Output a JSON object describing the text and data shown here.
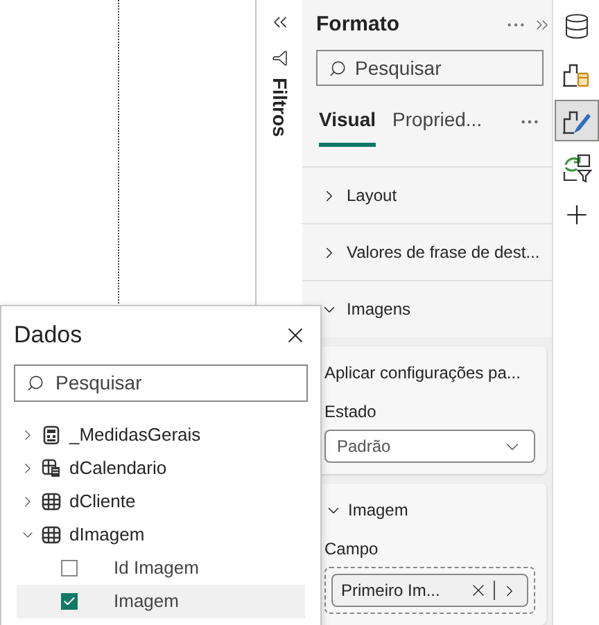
{
  "filters_pane": {
    "label": "Filtros"
  },
  "format_pane": {
    "title": "Formato",
    "search": {
      "placeholder": "Pesquisar"
    },
    "tabs": [
      {
        "label": "Visual",
        "selected": true
      },
      {
        "label": "Propried...",
        "selected": false
      }
    ],
    "sections": [
      {
        "label": "Layout",
        "expanded": false
      },
      {
        "label": "Valores de frase de dest...",
        "expanded": false
      },
      {
        "label": "Imagens",
        "expanded": true
      }
    ],
    "cards": [
      {
        "kind": "dropdown",
        "title": "Aplicar configurações pa...",
        "field_label": "Estado",
        "value": "Padrão"
      },
      {
        "kind": "field-well",
        "title": "Imagem",
        "expanded": true,
        "field_label": "Campo",
        "value": "Primeiro Im..."
      }
    ]
  },
  "rail": [
    {
      "kind": "data",
      "selected": false
    },
    {
      "kind": "build",
      "selected": false
    },
    {
      "kind": "format",
      "selected": true
    },
    {
      "kind": "analytics",
      "selected": false
    },
    {
      "kind": "add",
      "selected": false
    }
  ],
  "data_pane": {
    "title": "Dados",
    "search": {
      "placeholder": "Pesquisar"
    },
    "tree": [
      {
        "label": "_MedidasGerais",
        "kind": "measures",
        "expanded": false
      },
      {
        "label": "dCalendario",
        "kind": "calendar",
        "expanded": false
      },
      {
        "label": "dCliente",
        "kind": "table",
        "expanded": false
      },
      {
        "label": "dImagem",
        "kind": "table",
        "expanded": true,
        "children": [
          {
            "label": "Id Imagem",
            "checked": false,
            "selected": false
          },
          {
            "label": "Imagem",
            "checked": true,
            "selected": true
          }
        ]
      }
    ]
  }
}
